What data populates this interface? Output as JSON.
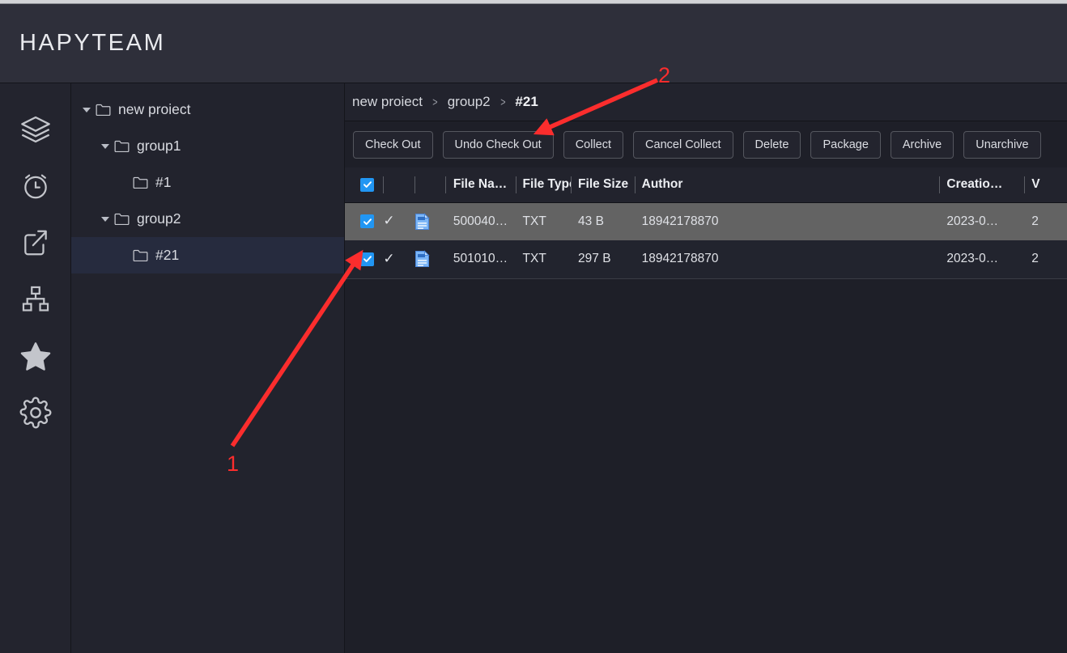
{
  "app": {
    "brand_title": "HAPYTEAM"
  },
  "rail": {
    "items": [
      {
        "name": "layers-icon",
        "label": "Layers"
      },
      {
        "name": "alarm-clock-icon",
        "label": "Recent"
      },
      {
        "name": "share-export-icon",
        "label": "Share"
      },
      {
        "name": "sitemap-icon",
        "label": "Structure"
      },
      {
        "name": "star-icon",
        "label": "Favorites"
      },
      {
        "name": "gear-icon",
        "label": "Settings"
      }
    ]
  },
  "tree": {
    "nodes": [
      {
        "label": "new proiect",
        "level": 1,
        "expanded": true,
        "has_children": true,
        "selected": false
      },
      {
        "label": "group1",
        "level": 2,
        "expanded": true,
        "has_children": true,
        "selected": false
      },
      {
        "label": "#1",
        "level": 3,
        "expanded": false,
        "has_children": false,
        "selected": false
      },
      {
        "label": "group2",
        "level": 2,
        "expanded": true,
        "has_children": true,
        "selected": false
      },
      {
        "label": "#21",
        "level": 3,
        "expanded": false,
        "has_children": false,
        "selected": true
      }
    ]
  },
  "breadcrumb": {
    "separator": ">",
    "items": [
      {
        "label": "new proiect",
        "current": false
      },
      {
        "label": "group2",
        "current": false
      },
      {
        "label": "#21",
        "current": true
      }
    ]
  },
  "toolbar": {
    "buttons": [
      {
        "label": "Check Out",
        "name": "check-out-button"
      },
      {
        "label": "Undo Check Out",
        "name": "undo-check-out-button"
      },
      {
        "label": "Collect",
        "name": "collect-button"
      },
      {
        "label": "Cancel Collect",
        "name": "cancel-collect-button"
      },
      {
        "label": "Delete",
        "name": "delete-button"
      },
      {
        "label": "Package",
        "name": "package-button"
      },
      {
        "label": "Archive",
        "name": "archive-button"
      },
      {
        "label": "Unarchive",
        "name": "unarchive-button"
      }
    ]
  },
  "table": {
    "select_all_checked": true,
    "headers": {
      "select": "",
      "flag": "",
      "icon": "",
      "file_name": "File Na…",
      "file_type": "File Type",
      "file_size": "File Size",
      "author": "Author",
      "creation_time": "Creatio…",
      "extra": "V"
    },
    "rows": [
      {
        "checked": true,
        "flag": "✓",
        "file_name": "500040…",
        "file_type": "TXT",
        "file_size": "43 B",
        "author": "18942178870",
        "creation_time": "2023-0…",
        "extra": "2",
        "highlighted": true
      },
      {
        "checked": true,
        "flag": "✓",
        "file_name": "501010…",
        "file_type": "TXT",
        "file_size": "297 B",
        "author": "18942178870",
        "creation_time": "2023-0…",
        "extra": "2",
        "highlighted": false
      }
    ]
  },
  "annotations": {
    "color": "#fb2d2d",
    "markers": [
      {
        "label": "1",
        "points_to": "row-2 select checkbox"
      },
      {
        "label": "2",
        "points_to": "undo-check-out-button"
      }
    ]
  },
  "colors": {
    "header_bg": "#2e2f3a",
    "panel_bg": "#22232d",
    "content_bg": "#1e1f28",
    "accent_checkbox": "#2196f3",
    "row_highlight": "#636363",
    "tree_selected": "#262b3e",
    "annotation_red": "#fb2d2d"
  }
}
